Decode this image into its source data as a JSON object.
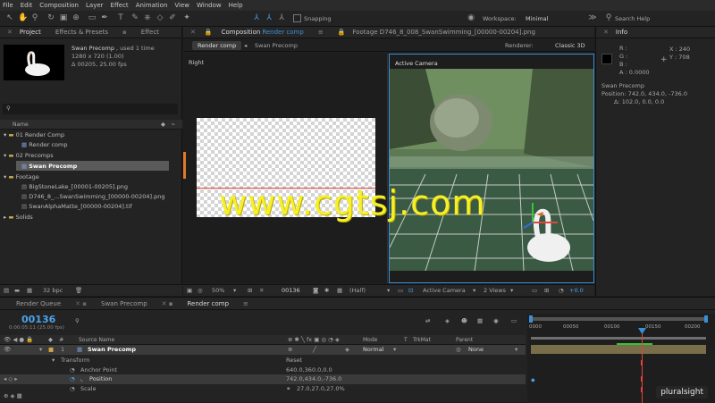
{
  "menu": [
    "File",
    "Edit",
    "Composition",
    "Layer",
    "Effect",
    "Animation",
    "View",
    "Window",
    "Help"
  ],
  "toolbar": {
    "snapping_label": "Snapping",
    "workspace_label": "Workspace:",
    "workspace_value": "Minimal",
    "search_placeholder": "Search Help"
  },
  "project_panel": {
    "tab_project": "Project",
    "tab_effects": "Effects & Presets",
    "tab_effect": "Effect",
    "selected_name": "Swan Precomp",
    "selected_usage": ", used 1 time",
    "selected_size": "1280 x 720 (1.00)",
    "selected_duration": "Δ 00205, 25.00 fps",
    "search_placeholder": "",
    "column_name": "Name",
    "tree": {
      "folder1": "01 Render Comp",
      "item1": "Render comp",
      "folder2": "02 Precomps",
      "item2": "Swan Precomp",
      "folder3": "Footage",
      "item3": "BigStoneLake_[00001-00205].png",
      "item4": "D746_8_...SwanSwimming_[00000-00204].png",
      "item5": "SwanAlphaMatte_[00000-00204].tif",
      "folder4": "Solids"
    },
    "bpc": "32 bpc"
  },
  "composition": {
    "tab_label": "Composition",
    "tab_comp_name": "Render comp",
    "footage_tab": "Footage  D746_8_008_SwanSwimming_[00000-00204].png",
    "breadcrumb_1": "Render comp",
    "breadcrumb_2": "Swan Precomp",
    "renderer_label": "Renderer:",
    "renderer_value": "Classic 3D",
    "view_left": "Right",
    "view_right": "Active Camera",
    "footer": {
      "zoom": "50%",
      "frame": "00136",
      "quality": "(Half)",
      "camera": "Active Camera",
      "views": "2 Views",
      "exposure": "+0.0"
    }
  },
  "info_panel": {
    "title": "Info",
    "r": "R :",
    "g": "G :",
    "b": "B :",
    "a": "A :  0.0000",
    "x": "X : 240",
    "y": "Y : 708",
    "layer_name": "Swan Precomp",
    "position": "Position: 742.0, 434.0, -736.0",
    "delta": "Δ: 102.0, 0.0, 0.0"
  },
  "timeline": {
    "tab_render_queue": "Render Queue",
    "tab_swan_precomp": "Swan Precomp",
    "tab_render_comp": "Render comp",
    "timecode": "00136",
    "timecode_sub": "0:00:05:11 (25.00 fps)",
    "col_source": "Source Name",
    "col_mode": "Mode",
    "col_t": "T",
    "col_trkmat": "TrkMat",
    "col_parent": "Parent",
    "layer_num": "1",
    "layer_name": "Swan Precomp",
    "layer_mode": "Normal",
    "layer_parent": "None",
    "transform_label": "Transform",
    "reset_label": "Reset",
    "anchor_label": "Anchor Point",
    "anchor_value": "640.0,360.0,0.0",
    "position_label": "Position",
    "position_value": "742.0,434.0,-736.0",
    "scale_label": "Scale",
    "scale_value": "27.0,27.0,27.0%",
    "ruler": [
      "0000",
      "00050",
      "00100",
      "00150",
      "00200"
    ]
  },
  "overlays": {
    "watermark": "www.cgtsj.com",
    "brand": "pluralsight"
  },
  "colors": {
    "accent_blue": "#3a8fd6",
    "playhead_red": "#e0443a",
    "watermark_yellow": "#f5f02a",
    "work_area": "#7a6d4a"
  }
}
